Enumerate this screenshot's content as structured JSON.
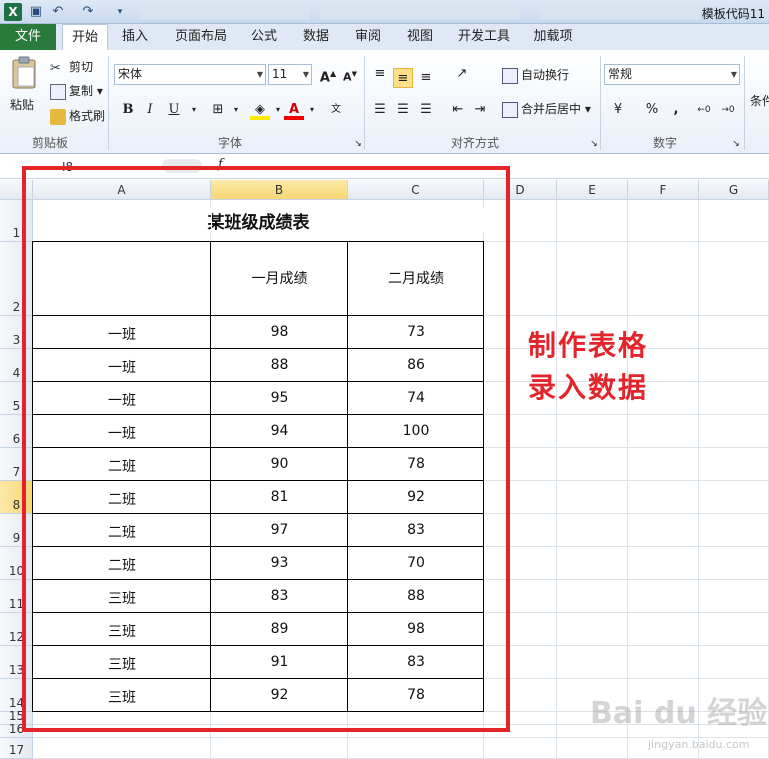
{
  "window": {
    "title": "模板代码11"
  },
  "ribbon_tabs": [
    "文件",
    "开始",
    "插入",
    "页面布局",
    "公式",
    "数据",
    "审阅",
    "视图",
    "开发工具",
    "加载项"
  ],
  "clipboard": {
    "paste": "粘贴",
    "cut": "剪切",
    "copy": "复制",
    "format_painter": "格式刷",
    "label": "剪贴板"
  },
  "font": {
    "name": "宋体",
    "size": "11",
    "label": "字体",
    "bold": "B",
    "italic": "I",
    "underline": "U",
    "grow": "A",
    "shrink": "A",
    "color_letter": "A"
  },
  "alignment": {
    "wrap": "自动换行",
    "merge": "合并后居中",
    "label": "对齐方式"
  },
  "number": {
    "format": "常规",
    "label": "数字",
    "percent": "%",
    "comma": ","
  },
  "styles": {
    "cond": "条件"
  },
  "formula_bar": {
    "name_box": "I8"
  },
  "columns": [
    "A",
    "B",
    "C",
    "D",
    "E",
    "F",
    "G"
  ],
  "rows": [
    "1",
    "2",
    "3",
    "4",
    "5",
    "6",
    "7",
    "8",
    "9",
    "10",
    "11",
    "12",
    "13",
    "14",
    "15",
    "16",
    "17"
  ],
  "sheet": {
    "title": "某班级成绩表",
    "header": [
      "",
      "一月成绩",
      "二月成绩"
    ],
    "data": [
      [
        "一班",
        "98",
        "73"
      ],
      [
        "一班",
        "88",
        "86"
      ],
      [
        "一班",
        "95",
        "74"
      ],
      [
        "一班",
        "94",
        "100"
      ],
      [
        "二班",
        "90",
        "78"
      ],
      [
        "二班",
        "81",
        "92"
      ],
      [
        "二班",
        "97",
        "83"
      ],
      [
        "二班",
        "93",
        "70"
      ],
      [
        "三班",
        "83",
        "88"
      ],
      [
        "三班",
        "89",
        "98"
      ],
      [
        "三班",
        "91",
        "83"
      ],
      [
        "三班",
        "92",
        "78"
      ]
    ]
  },
  "annotation": {
    "line1": "制作表格",
    "line2": "录入数据"
  },
  "watermark": {
    "brand": "Bai du 经验",
    "url": "jingyan.baidu.com"
  },
  "colors": {
    "excel_green": "#1e7145",
    "accent_red": "#e3242b",
    "selection": "#f7d774"
  }
}
